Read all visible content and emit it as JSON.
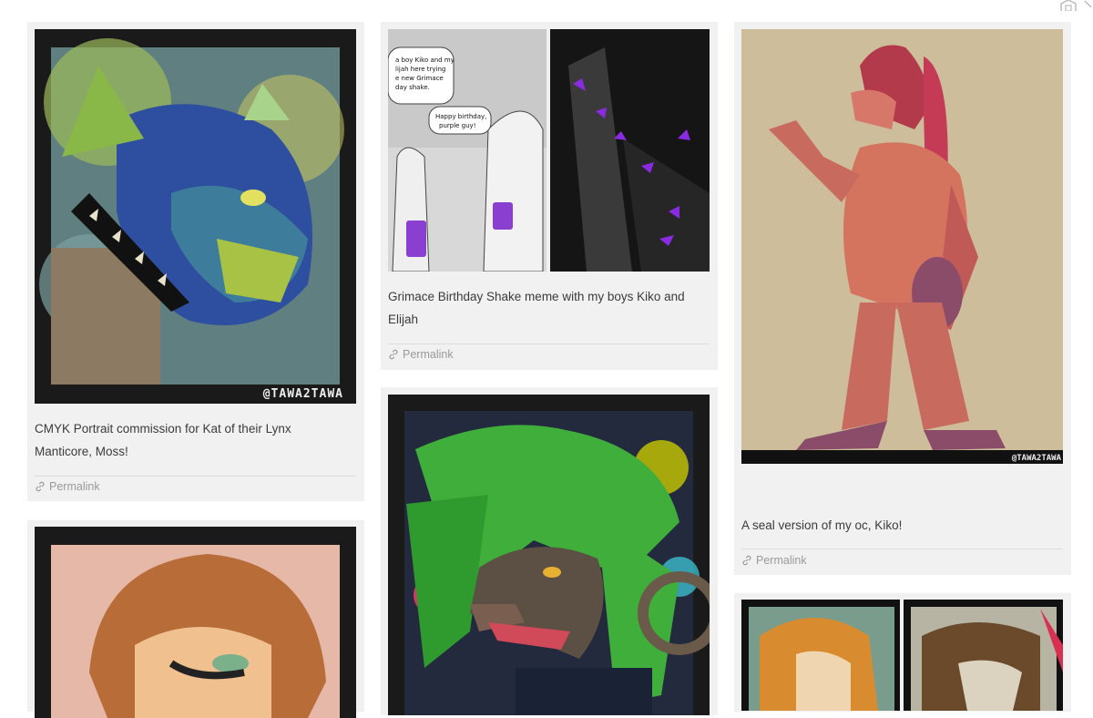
{
  "posts": [
    {
      "caption": "CMYK Portrait commission for Kat of their Lynx Manticore, Moss!",
      "watermark": "@TAWA2TAWA",
      "permalink": "Permalink"
    },
    {
      "caption": "Grimace Birthday Shake meme with my boys Kiko and Elijah",
      "bubble1": "...a boy Kiko and my\n...lijah here trying\n...e new Grimace\n...day shake.",
      "bubble2": "Happy birthday,\npurple guy!",
      "permalink": "Permalink"
    },
    {
      "caption": "A seal version of my oc, Kiko!",
      "watermark": "@TAWA2TAWA",
      "permalink": "Permalink"
    }
  ],
  "colors": {
    "card_bg": "#f1f1f1",
    "link": "#9a9a9a",
    "text": "#3b3b3b"
  },
  "icons": [
    "link-icon",
    "home-icon",
    "chevron-icon"
  ]
}
